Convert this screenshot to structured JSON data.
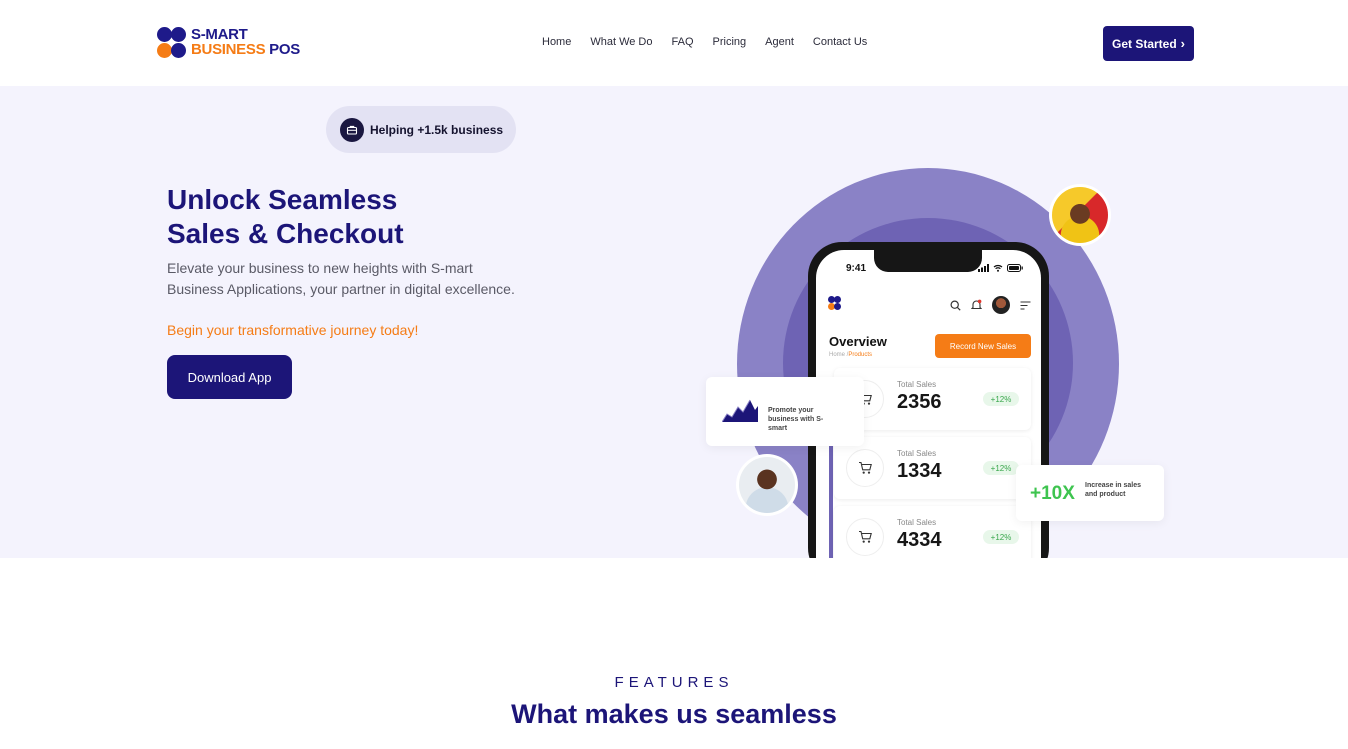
{
  "brand": {
    "line1": "S-MART",
    "line2": "BUSINESS",
    "line3": "POS",
    "logo_colors": [
      "#1e1a8a",
      "#f57c16"
    ]
  },
  "nav": {
    "items": [
      "Home",
      "What We Do",
      "FAQ",
      "Pricing",
      "Agent",
      "Contact Us"
    ]
  },
  "header": {
    "cta_label": "Get Started",
    "cta_icon": "chevron-right-icon"
  },
  "hero": {
    "badge": "Helping +1.5k business",
    "badge_icon": "briefcase-icon",
    "title_line1": "Unlock Seamless",
    "title_line2": "Sales & Checkout",
    "description": "Elevate your business to new heights with S-mart Business Applications, your partner in digital excellence.",
    "accent": "Begin your transformative journey today!",
    "download_label": "Download App"
  },
  "phone": {
    "time": "9:41",
    "overview": "Overview",
    "crumb_home": "Home /",
    "crumb_current": "Products",
    "record_label": "Record New Sales",
    "cards": [
      {
        "label": "Total Sales",
        "value": "2356",
        "change": "+12%"
      },
      {
        "label": "Total Sales",
        "value": "1334",
        "change": "+12%"
      },
      {
        "label": "Total Sales",
        "value": "4334",
        "change": "+12%"
      }
    ]
  },
  "floats": {
    "promo": "Promote your business with S-smart",
    "multiplier": "+10X",
    "multiplier_text": "Increase in sales and product"
  },
  "features": {
    "kicker": "FEATURES",
    "title": "What makes us seamless"
  },
  "colors": {
    "primary": "#1c1578",
    "accent": "#f57c16",
    "hero_bg": "#f4f3fd",
    "blob": "#8a82c6",
    "positive": "#3ec44f"
  }
}
